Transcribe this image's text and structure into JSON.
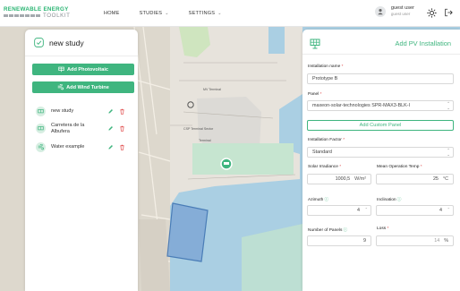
{
  "header": {
    "logo_line1": "RENEWABLE ENERGY",
    "logo_line2": "TOOLKIT",
    "nav": [
      {
        "label": "HOME"
      },
      {
        "label": "STUDIES"
      },
      {
        "label": "SETTINGS"
      }
    ],
    "user": {
      "name": "guest user",
      "role": "guest user"
    }
  },
  "sidebar": {
    "title": "new study",
    "add_photovoltaic": "Add Photovoltaic",
    "add_wind_turbine": "Add Wind Turbine",
    "items": [
      {
        "label": "new study"
      },
      {
        "label": "Carretera de la Albufera"
      },
      {
        "label": "Water example"
      }
    ]
  },
  "map": {
    "labels": [
      "MV Terminal",
      "CSP Terminal Sector",
      "Terminal"
    ]
  },
  "form": {
    "title": "Add PV Installation",
    "installation_name_label": "Installation name",
    "installation_name_value": "Prototype B",
    "panel_label": "Panel",
    "panel_value": "maxeon-solar-technologies SPR-MAX3-BLK-I",
    "add_custom_panel": "Add Custom Panel",
    "installation_factor_label": "Installation Factor",
    "installation_factor_value": "Standard",
    "solar_irradiance_label": "Solar Irradiance",
    "solar_irradiance_value": "1000,5",
    "solar_irradiance_unit": "W/m²",
    "mean_temp_label": "Mean Operation Temp",
    "mean_temp_value": "25",
    "mean_temp_unit": "°C",
    "azimuth_label": "Azimuth",
    "azimuth_value": "4",
    "inclination_label": "Inclination",
    "inclination_value": "4",
    "num_panels_label": "Number of Panels",
    "num_panels_value": "9",
    "loss_label": "Loss",
    "loss_value": "14",
    "loss_unit": "%"
  },
  "colors": {
    "accent": "#3fb57f",
    "required": "#e04848",
    "map_water": "#aacfe3"
  }
}
